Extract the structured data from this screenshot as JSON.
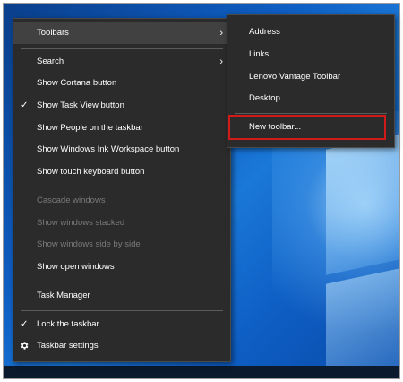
{
  "context_menu": {
    "items": [
      {
        "label": "Toolbars",
        "arrow": "›",
        "enabled": true,
        "checked": false,
        "hover": true
      },
      {
        "label": "Search",
        "arrow": "›",
        "enabled": true,
        "checked": false
      },
      {
        "label": "Show Cortana button",
        "enabled": true,
        "checked": false
      },
      {
        "label": "Show Task View button",
        "enabled": true,
        "checked": true,
        "check_glyph": "✓"
      },
      {
        "label": "Show People on the taskbar",
        "enabled": true,
        "checked": false
      },
      {
        "label": "Show Windows Ink Workspace button",
        "enabled": true,
        "checked": false
      },
      {
        "label": "Show touch keyboard button",
        "enabled": true,
        "checked": false
      },
      {
        "label": "Cascade windows",
        "enabled": false,
        "checked": false
      },
      {
        "label": "Show windows stacked",
        "enabled": false,
        "checked": false
      },
      {
        "label": "Show windows side by side",
        "enabled": false,
        "checked": false
      },
      {
        "label": "Show open windows",
        "enabled": true,
        "checked": false
      },
      {
        "label": "Task Manager",
        "enabled": true,
        "checked": false
      },
      {
        "label": "Lock the taskbar",
        "enabled": true,
        "checked": true,
        "check_glyph": "✓"
      },
      {
        "label": "Taskbar settings",
        "enabled": true,
        "checked": false,
        "icon": "gear-icon"
      }
    ]
  },
  "toolbars_submenu": {
    "items": [
      {
        "label": "Address"
      },
      {
        "label": "Links"
      },
      {
        "label": "Lenovo Vantage Toolbar"
      },
      {
        "label": "Desktop"
      },
      {
        "label": "New toolbar...",
        "highlighted": true
      }
    ]
  },
  "colors": {
    "menu_bg": "#2b2b2b",
    "menu_text": "#ffffff",
    "disabled_text": "#7a7a7a",
    "highlight_border": "#d11b1b"
  }
}
